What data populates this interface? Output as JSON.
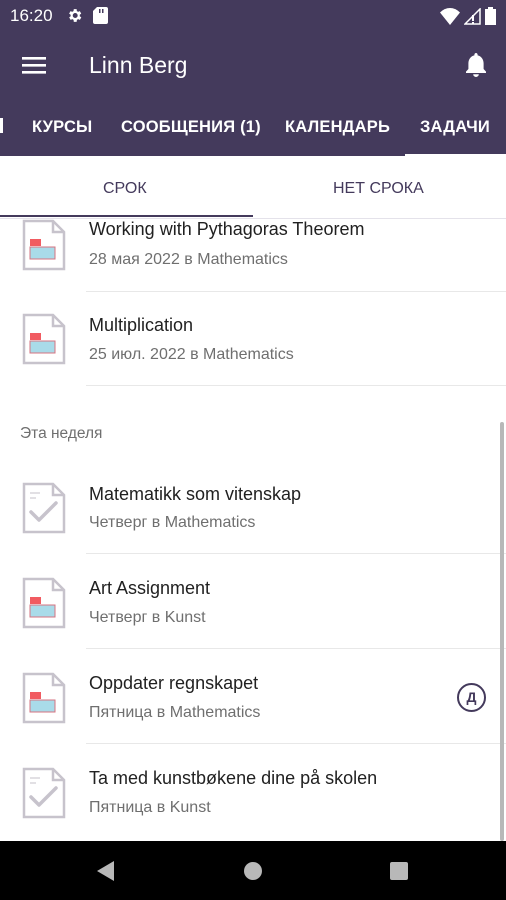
{
  "status_bar": {
    "time": "16:20"
  },
  "app_bar": {
    "title": "Linn Berg"
  },
  "course_tabs": [
    "КУРСЫ",
    "СООБЩЕНИЯ (1)",
    "КАЛЕНДАРЬ",
    "ЗАДАЧИ"
  ],
  "sub_tabs": [
    "СРОК",
    "НЕТ СРОКА"
  ],
  "tasks_earlier": [
    {
      "title": "Working with Pythagoras Theorem",
      "subtitle": "28 мая 2022 в Mathematics",
      "icon": "assignment-doc-icon"
    },
    {
      "title": "Multiplication",
      "subtitle": "25 июл. 2022 в Mathematics",
      "icon": "assignment-doc-icon"
    }
  ],
  "section_this_week": "Эта неделя",
  "tasks_this_week": [
    {
      "title": "Matematikk som vitenskap",
      "subtitle": "Четверг в Mathematics",
      "icon": "checked-doc-icon"
    },
    {
      "title": "Art Assignment",
      "subtitle": "Четверг в Kunst",
      "icon": "assignment-doc-icon"
    },
    {
      "title": "Oppdater regnskapet",
      "subtitle": "Пятница в Mathematics",
      "icon": "assignment-doc-icon",
      "badge": "Д"
    },
    {
      "title": "Ta med kunstbøkene dine på skolen",
      "subtitle": "Пятница в Kunst",
      "icon": "checked-doc-icon"
    }
  ],
  "colors": {
    "primary": "#443a5c",
    "doc_red": "#f15b61",
    "doc_blue": "#a9dbe9"
  }
}
